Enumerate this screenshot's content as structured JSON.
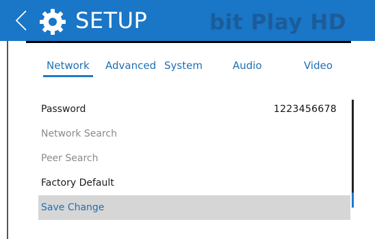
{
  "header": {
    "title": "SETUP",
    "brand": "bit Play HD",
    "back_icon": "chevron-left-icon",
    "settings_icon": "gear-icon",
    "bg_color": "#1a76c6"
  },
  "tabs": [
    {
      "label": "Network",
      "active": true
    },
    {
      "label": "Advanced",
      "active": false
    },
    {
      "label": "System",
      "active": false
    },
    {
      "label": "Audio",
      "active": false
    },
    {
      "label": "Video",
      "active": false
    }
  ],
  "list": [
    {
      "label": "Password",
      "value": "1223456678"
    },
    {
      "label": "Network Search"
    },
    {
      "label": "Peer Search"
    },
    {
      "label": "Factory Default"
    },
    {
      "label": "Save Change",
      "selected": true
    }
  ],
  "colors": {
    "accent": "#1d78c8",
    "selected_row": "#d6d6d6",
    "dim_text": "#8a8a8a"
  }
}
